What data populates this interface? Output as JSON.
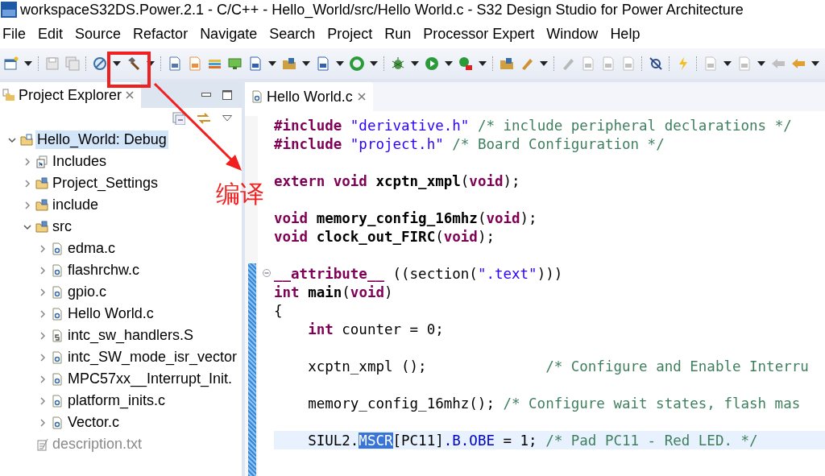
{
  "window": {
    "title": "workspaceS32DS.Power.2.1 - C/C++ - Hello_World/src/Hello World.c - S32 Design Studio for Power Architecture"
  },
  "menu": [
    "File",
    "Edit",
    "Source",
    "Refactor",
    "Navigate",
    "Search",
    "Project",
    "Run",
    "Processor Expert",
    "Window",
    "Help"
  ],
  "explorer": {
    "title": "Project Explorer",
    "tree": [
      {
        "label": "Hello_World: Debug",
        "kind": "project",
        "expanded": true,
        "selected": true,
        "children": [
          {
            "label": "Includes",
            "kind": "includes",
            "expanded": false,
            "selected": false
          },
          {
            "label": "Project_Settings",
            "kind": "folder",
            "expanded": false,
            "selected": false
          },
          {
            "label": "include",
            "kind": "folder",
            "expanded": false,
            "selected": false
          },
          {
            "label": "src",
            "kind": "folder",
            "expanded": true,
            "selected": false,
            "children": [
              {
                "label": "edma.c",
                "kind": "c",
                "expanded": false,
                "selected": false
              },
              {
                "label": "flashrchw.c",
                "kind": "c",
                "expanded": false,
                "selected": false
              },
              {
                "label": "gpio.c",
                "kind": "c",
                "expanded": false,
                "selected": false
              },
              {
                "label": "Hello World.c",
                "kind": "c",
                "expanded": false,
                "selected": false
              },
              {
                "label": "intc_sw_handlers.S",
                "kind": "asm",
                "expanded": false,
                "selected": false
              },
              {
                "label": "intc_SW_mode_isr_vector",
                "kind": "c",
                "expanded": false,
                "selected": false
              },
              {
                "label": "MPC57xx__Interrupt_Init.",
                "kind": "c",
                "expanded": false,
                "selected": false
              },
              {
                "label": "platform_inits.c",
                "kind": "c",
                "expanded": false,
                "selected": false
              },
              {
                "label": "Vector.c",
                "kind": "c",
                "expanded": false,
                "selected": false
              }
            ]
          },
          {
            "label": "description.txt",
            "kind": "text",
            "selected": false
          }
        ]
      }
    ]
  },
  "editor": {
    "tab": "Hello World.c",
    "lines": [
      {
        "kind": "code",
        "tokens": [
          {
            "kind": "kw",
            "text": "#include"
          },
          {
            "kind": "str",
            "text": " \"derivative.h\""
          },
          {
            "kind": "com",
            "text": " /* include peripheral declarations */"
          }
        ]
      },
      {
        "kind": "code",
        "tokens": [
          {
            "kind": "kw",
            "text": "#include"
          },
          {
            "kind": "str",
            "text": " \"project.h\""
          },
          {
            "kind": "com",
            "text": " /* Board Configuration */"
          }
        ]
      },
      {
        "kind": "blank"
      },
      {
        "kind": "code",
        "tokens": [
          {
            "kind": "kw",
            "text": "extern"
          },
          {
            "kind": "kw",
            "text": " void"
          },
          {
            "kind": "decl",
            "text": " xcptn_xmpl"
          },
          {
            "kind": "plain",
            "text": "("
          },
          {
            "kind": "kw",
            "text": "void"
          },
          {
            "kind": "plain",
            "text": ");"
          }
        ]
      },
      {
        "kind": "blank"
      },
      {
        "kind": "code",
        "tokens": [
          {
            "kind": "kw",
            "text": "void"
          },
          {
            "kind": "decl",
            "text": " memory_config_16mhz"
          },
          {
            "kind": "plain",
            "text": "("
          },
          {
            "kind": "kw",
            "text": "void"
          },
          {
            "kind": "plain",
            "text": ");"
          }
        ]
      },
      {
        "kind": "code",
        "tokens": [
          {
            "kind": "kw",
            "text": "void"
          },
          {
            "kind": "decl",
            "text": " clock_out_FIRC"
          },
          {
            "kind": "plain",
            "text": "("
          },
          {
            "kind": "kw",
            "text": "void"
          },
          {
            "kind": "plain",
            "text": ");"
          }
        ]
      },
      {
        "kind": "blank"
      },
      {
        "kind": "code",
        "collapsed": false,
        "tokens": [
          {
            "kind": "kw",
            "text": "__attribute__"
          },
          {
            "kind": "plain",
            "text": " ((section("
          },
          {
            "kind": "str",
            "text": "\".text\""
          },
          {
            "kind": "plain",
            "text": ")))"
          }
        ]
      },
      {
        "kind": "code",
        "tokens": [
          {
            "kind": "kw",
            "text": "int"
          },
          {
            "kind": "decl",
            "text": " main"
          },
          {
            "kind": "plain",
            "text": "("
          },
          {
            "kind": "kw",
            "text": "void"
          },
          {
            "kind": "plain",
            "text": ")"
          }
        ]
      },
      {
        "kind": "code",
        "tokens": [
          {
            "kind": "plain",
            "text": "{"
          }
        ]
      },
      {
        "kind": "code",
        "tokens": [
          {
            "kind": "kw",
            "text": "    int"
          },
          {
            "kind": "plain",
            "text": " counter = 0;"
          }
        ]
      },
      {
        "kind": "blank"
      },
      {
        "kind": "code",
        "tokens": [
          {
            "kind": "plain",
            "text": "    xcptn_xmpl ();"
          },
          {
            "kind": "com",
            "text": "              /* Configure and Enable Interru"
          }
        ]
      },
      {
        "kind": "blank"
      },
      {
        "kind": "code",
        "tokens": [
          {
            "kind": "plain",
            "text": "    memory_config_16mhz();"
          },
          {
            "kind": "com",
            "text": " /* Configure wait states, flash mas"
          }
        ]
      },
      {
        "kind": "blank"
      },
      {
        "kind": "code",
        "current": true,
        "tokens": [
          {
            "kind": "plain",
            "text": "    SIUL2."
          },
          {
            "kind": "sel",
            "text": "MSCR"
          },
          {
            "kind": "plain",
            "text": "[PC11]"
          },
          {
            "kind": "field",
            "text": ".B.OBE"
          },
          {
            "kind": "plain",
            "text": " = 1;"
          },
          {
            "kind": "com",
            "text": " /* Pad PC11 - Red LED. */"
          }
        ]
      }
    ]
  },
  "annotation": {
    "label": "编译"
  }
}
